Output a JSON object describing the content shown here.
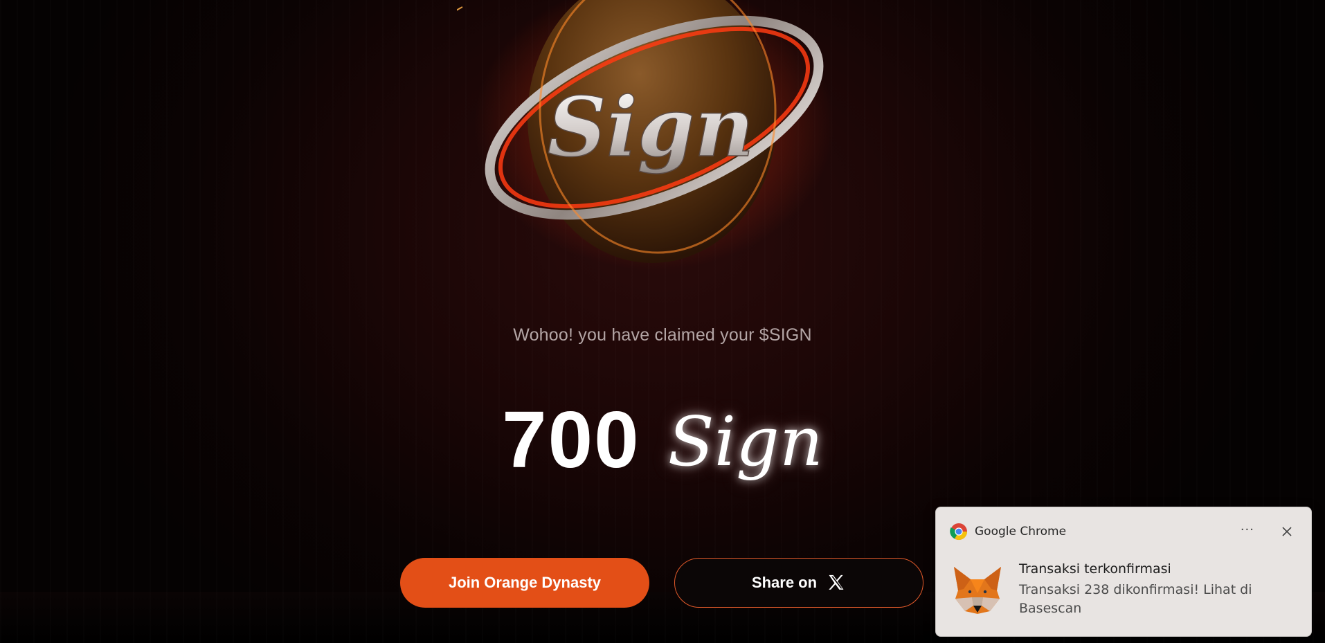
{
  "hero": {
    "logo_text": "Sign"
  },
  "claim": {
    "message": "Wohoo! you have claimed your $SIGN",
    "amount": "700",
    "unit": "Sign"
  },
  "buttons": {
    "join_label": "Join Orange Dynasty",
    "share_label": "Share on"
  },
  "notification": {
    "app_name": "Google Chrome",
    "more_label": "···",
    "title": "Transaksi terkonfirmasi",
    "body": "Transaksi 238 dikonfirmasi! Lihat di Basescan"
  },
  "colors": {
    "accent": "#e34f17",
    "background": "#1a0606",
    "toast_bg": "#e8e4e2"
  },
  "icons": {
    "share_target": "x-logo-icon",
    "toast_app": "chrome-icon",
    "toast_sender": "metamask-fox-icon",
    "toast_close": "close-icon"
  }
}
